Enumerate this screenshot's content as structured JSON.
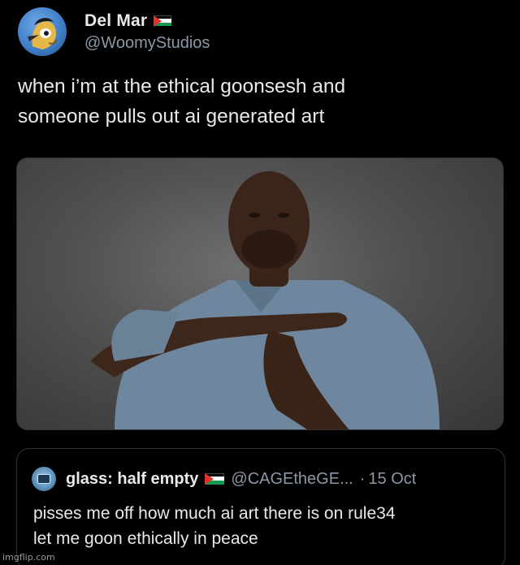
{
  "post": {
    "author": {
      "display_name": "Del Mar",
      "handle": "@WoomyStudios",
      "flag_icon": "palestine-flag-icon"
    },
    "text": "when i’m at the ethical goonsesh and\nsomeone pulls out ai generated art"
  },
  "quoted_post": {
    "author": {
      "display_name": "glass: half empty",
      "handle": "@CAGEtheGE...",
      "flag_icon": "palestine-flag-icon"
    },
    "separator": "·",
    "date": "15 Oct",
    "text": "pisses me off how much ai art there is on rule34\nlet me goon ethically in peace"
  },
  "watermark": "imgflip.com",
  "colors": {
    "background": "#000000",
    "text_primary": "#e7e9ea",
    "text_secondary": "#8b98a5",
    "border": "#2f3336"
  }
}
